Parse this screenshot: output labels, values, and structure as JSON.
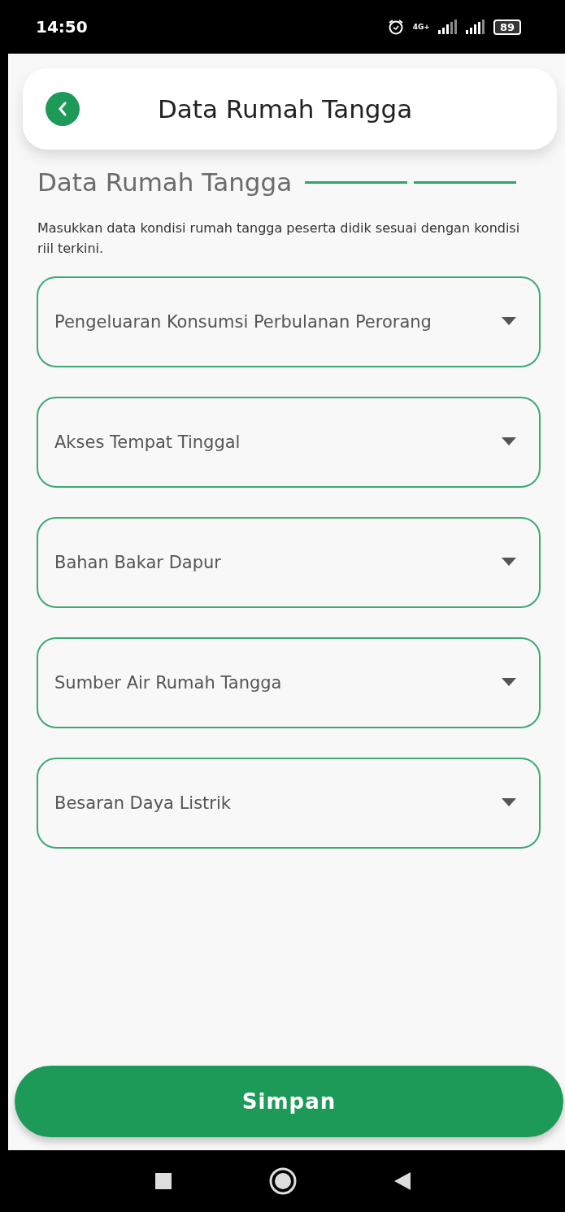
{
  "status_bar": {
    "time": "14:50",
    "network": "4G+",
    "battery": "89"
  },
  "header": {
    "title": "Data Rumah Tangga"
  },
  "section": {
    "title": "Data Rumah Tangga",
    "steps": [
      {
        "done": true
      },
      {
        "done": true
      }
    ],
    "description": "Masukkan data kondisi rumah tangga peserta didik sesuai dengan kondisi riil terkini."
  },
  "fields": [
    {
      "placeholder": "Pengeluaran Konsumsi Perbulanan Perorang"
    },
    {
      "placeholder": "Akses Tempat Tinggal"
    },
    {
      "placeholder": "Bahan Bakar Dapur"
    },
    {
      "placeholder": "Sumber Air Rumah Tangga"
    },
    {
      "placeholder": "Besaran Daya Listrik"
    }
  ],
  "save_button": "Simpan"
}
